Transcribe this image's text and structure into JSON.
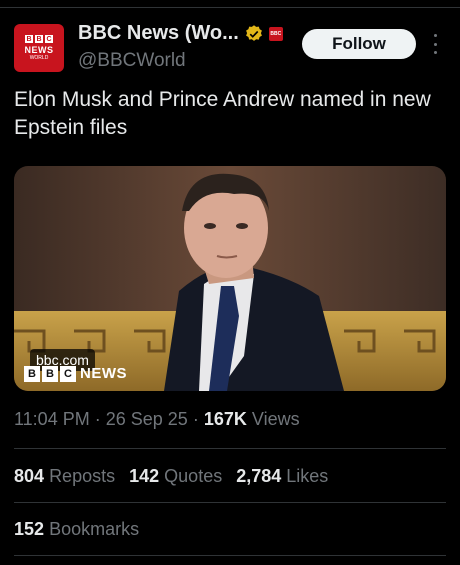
{
  "account": {
    "name": "BBC News (Wo...",
    "handle": "@BBCWorld",
    "avatar_blocks": [
      "B",
      "B",
      "C"
    ],
    "avatar_news": "NEWS",
    "avatar_world": "WORLD",
    "affiliate_badge": "BBC",
    "verified_color": "#e2b719"
  },
  "follow_label": "Follow",
  "tweet_text": "Elon Musk and Prince Andrew named in new Epstein files",
  "media": {
    "domain": "bbc.com",
    "watermark_blocks": [
      "B",
      "B",
      "C"
    ],
    "watermark_text": "NEWS"
  },
  "meta": {
    "time": "11:04 PM",
    "dot1": "·",
    "date": "26 Sep 25",
    "dot2": "·",
    "views_count": "167K",
    "views_label": "Views"
  },
  "stats": {
    "reposts_count": "804",
    "reposts_label": "Reposts",
    "quotes_count": "142",
    "quotes_label": "Quotes",
    "likes_count": "2,784",
    "likes_label": "Likes",
    "bookmarks_count": "152",
    "bookmarks_label": "Bookmarks"
  },
  "icons": [
    "bbc-news-avatar-icon",
    "verified-badge-icon",
    "affiliate-badge-icon",
    "more-options-icon"
  ]
}
